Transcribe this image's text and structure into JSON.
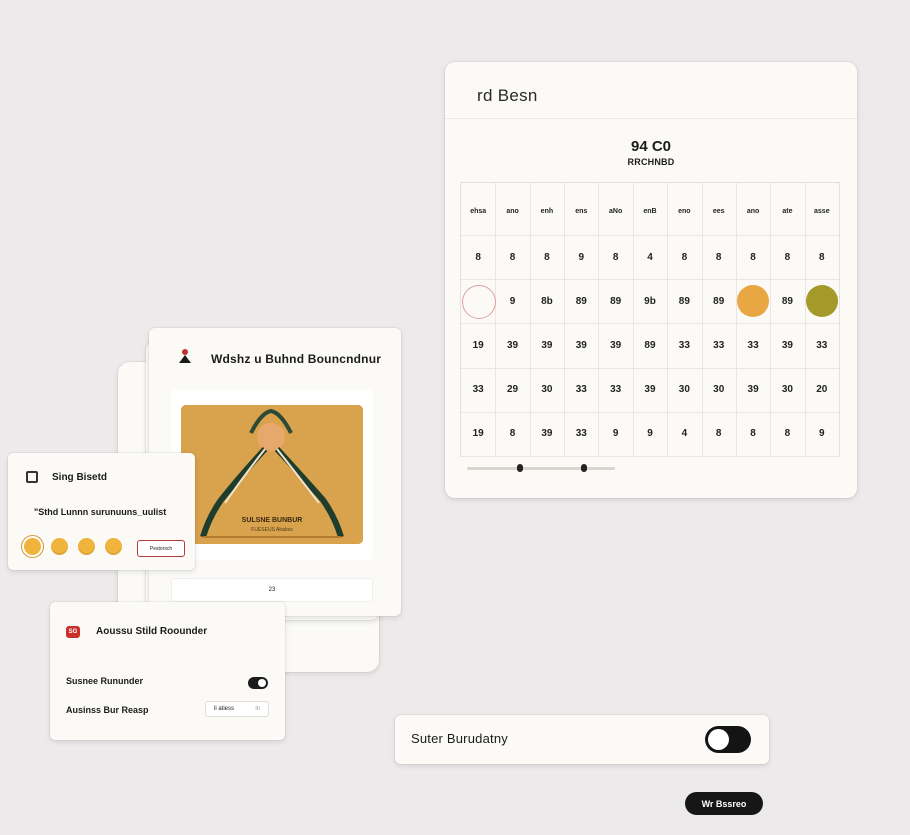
{
  "calendar": {
    "title": "rd Besn",
    "time": "94 C0",
    "subtitle": "RRCHNBD",
    "weekdays": [
      "ehsa",
      "ano",
      "enh",
      "ens",
      "aNo",
      "enB",
      "eno",
      "ees",
      "ano",
      "ate",
      "asse"
    ],
    "weekday_sub": [
      "",
      "",
      "",
      "",
      "",
      "",
      "",
      "",
      "",
      "",
      ""
    ],
    "rows": [
      [
        "8",
        "8",
        "8",
        "9",
        "8",
        "4",
        "8",
        "8",
        "8",
        "8",
        "8"
      ],
      [
        "",
        "9",
        "8b",
        "89",
        "89",
        "9b",
        "89",
        "89",
        "",
        "89",
        ""
      ],
      [
        "19",
        "39",
        "39",
        "39",
        "39",
        "89",
        "33",
        "33",
        "33",
        "39",
        "33"
      ],
      [
        "33",
        "29",
        "30",
        "33",
        "33",
        "39",
        "30",
        "30",
        "39",
        "30",
        "20"
      ],
      [
        "19",
        "8",
        "39",
        "33",
        "9",
        "9",
        "4",
        "8",
        "8",
        "8",
        "9"
      ]
    ],
    "accent_today": "#e8a742",
    "accent_marked": "#a39a2a"
  },
  "art_card": {
    "title": "Wdshz u Buhnd Bouncndnur",
    "caption": "SULSNE BUNBUR",
    "caption_sub": "FUESEUS Alrabss",
    "footer": "23"
  },
  "rating": {
    "title": "Sing Bisetd",
    "subtitle": "\"Sthd Lunnn surunuuns_uulist",
    "button": "Pestorsch"
  },
  "settings": {
    "badge": "SG",
    "title": "Aoussu Stild Roounder",
    "row1_label": "Susnee Rununder",
    "row2_label": "Ausinss Bur Reasp",
    "input_value": "li atiess",
    "input_suffix": "ln"
  },
  "toggle_bar": {
    "label": "Suter Burudatny"
  },
  "pill": {
    "label": "Wr Bssreo"
  }
}
